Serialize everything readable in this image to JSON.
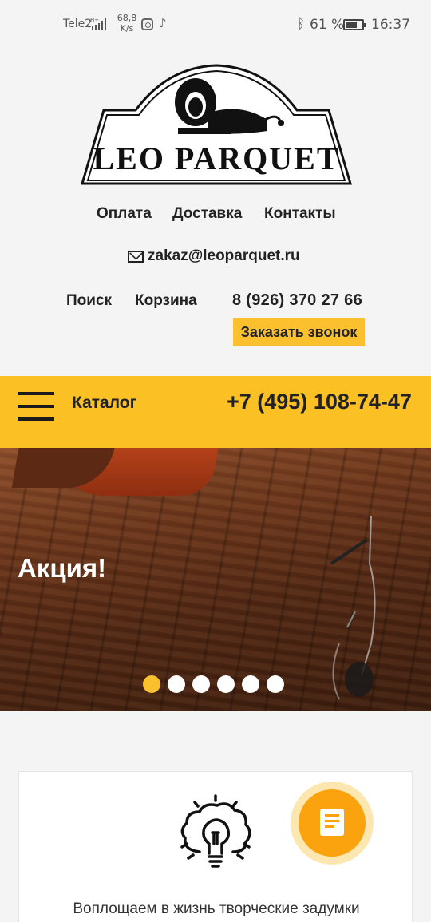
{
  "status_bar": {
    "carrier": "Tele2",
    "speed_value": "68,8",
    "speed_unit": "K/s",
    "battery": "61 %",
    "time": "16:37"
  },
  "header": {
    "logo_text": "LEO PARQUET",
    "nav": [
      "Оплата",
      "Доставка",
      "Контакты"
    ],
    "email": "zakaz@leoparquet.ru",
    "search": "Поиск",
    "cart": "Корзина",
    "phone": "8 (926) 370 27 66",
    "callback_button": "Заказать звонок"
  },
  "catalog_bar": {
    "label": "Каталог",
    "phone": "+7 (495) 108-74-47"
  },
  "banner": {
    "title": "Акция!",
    "slide_count": 6,
    "active_slide": 1
  },
  "card": {
    "text": "Воплощаем в жизнь творческие задумки"
  },
  "colors": {
    "accent": "#fbc124",
    "badge": "#fba20f",
    "background": "#f4f4f4"
  }
}
